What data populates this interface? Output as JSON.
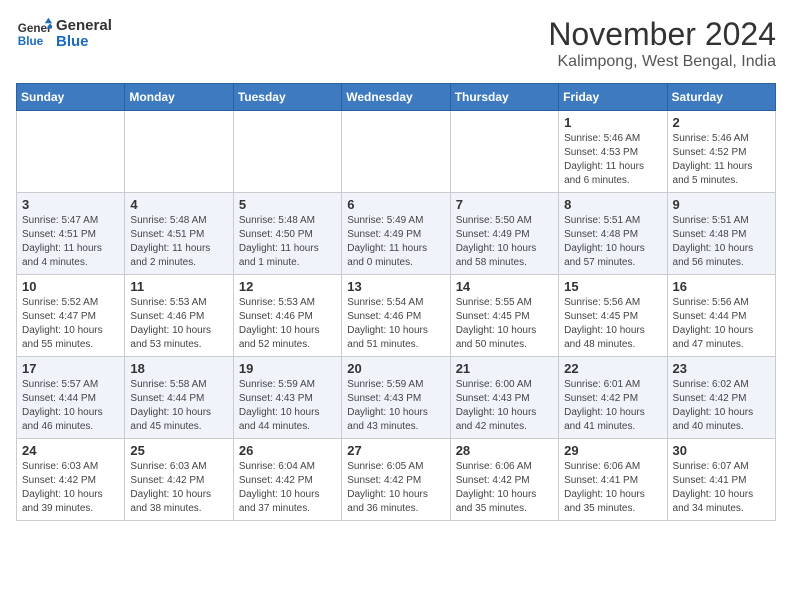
{
  "header": {
    "logo_general": "General",
    "logo_blue": "Blue",
    "month": "November 2024",
    "location": "Kalimpong, West Bengal, India"
  },
  "days_of_week": [
    "Sunday",
    "Monday",
    "Tuesday",
    "Wednesday",
    "Thursday",
    "Friday",
    "Saturday"
  ],
  "weeks": [
    [
      {
        "num": "",
        "info": ""
      },
      {
        "num": "",
        "info": ""
      },
      {
        "num": "",
        "info": ""
      },
      {
        "num": "",
        "info": ""
      },
      {
        "num": "",
        "info": ""
      },
      {
        "num": "1",
        "info": "Sunrise: 5:46 AM\nSunset: 4:53 PM\nDaylight: 11 hours and 6 minutes."
      },
      {
        "num": "2",
        "info": "Sunrise: 5:46 AM\nSunset: 4:52 PM\nDaylight: 11 hours and 5 minutes."
      }
    ],
    [
      {
        "num": "3",
        "info": "Sunrise: 5:47 AM\nSunset: 4:51 PM\nDaylight: 11 hours and 4 minutes."
      },
      {
        "num": "4",
        "info": "Sunrise: 5:48 AM\nSunset: 4:51 PM\nDaylight: 11 hours and 2 minutes."
      },
      {
        "num": "5",
        "info": "Sunrise: 5:48 AM\nSunset: 4:50 PM\nDaylight: 11 hours and 1 minute."
      },
      {
        "num": "6",
        "info": "Sunrise: 5:49 AM\nSunset: 4:49 PM\nDaylight: 11 hours and 0 minutes."
      },
      {
        "num": "7",
        "info": "Sunrise: 5:50 AM\nSunset: 4:49 PM\nDaylight: 10 hours and 58 minutes."
      },
      {
        "num": "8",
        "info": "Sunrise: 5:51 AM\nSunset: 4:48 PM\nDaylight: 10 hours and 57 minutes."
      },
      {
        "num": "9",
        "info": "Sunrise: 5:51 AM\nSunset: 4:48 PM\nDaylight: 10 hours and 56 minutes."
      }
    ],
    [
      {
        "num": "10",
        "info": "Sunrise: 5:52 AM\nSunset: 4:47 PM\nDaylight: 10 hours and 55 minutes."
      },
      {
        "num": "11",
        "info": "Sunrise: 5:53 AM\nSunset: 4:46 PM\nDaylight: 10 hours and 53 minutes."
      },
      {
        "num": "12",
        "info": "Sunrise: 5:53 AM\nSunset: 4:46 PM\nDaylight: 10 hours and 52 minutes."
      },
      {
        "num": "13",
        "info": "Sunrise: 5:54 AM\nSunset: 4:46 PM\nDaylight: 10 hours and 51 minutes."
      },
      {
        "num": "14",
        "info": "Sunrise: 5:55 AM\nSunset: 4:45 PM\nDaylight: 10 hours and 50 minutes."
      },
      {
        "num": "15",
        "info": "Sunrise: 5:56 AM\nSunset: 4:45 PM\nDaylight: 10 hours and 48 minutes."
      },
      {
        "num": "16",
        "info": "Sunrise: 5:56 AM\nSunset: 4:44 PM\nDaylight: 10 hours and 47 minutes."
      }
    ],
    [
      {
        "num": "17",
        "info": "Sunrise: 5:57 AM\nSunset: 4:44 PM\nDaylight: 10 hours and 46 minutes."
      },
      {
        "num": "18",
        "info": "Sunrise: 5:58 AM\nSunset: 4:44 PM\nDaylight: 10 hours and 45 minutes."
      },
      {
        "num": "19",
        "info": "Sunrise: 5:59 AM\nSunset: 4:43 PM\nDaylight: 10 hours and 44 minutes."
      },
      {
        "num": "20",
        "info": "Sunrise: 5:59 AM\nSunset: 4:43 PM\nDaylight: 10 hours and 43 minutes."
      },
      {
        "num": "21",
        "info": "Sunrise: 6:00 AM\nSunset: 4:43 PM\nDaylight: 10 hours and 42 minutes."
      },
      {
        "num": "22",
        "info": "Sunrise: 6:01 AM\nSunset: 4:42 PM\nDaylight: 10 hours and 41 minutes."
      },
      {
        "num": "23",
        "info": "Sunrise: 6:02 AM\nSunset: 4:42 PM\nDaylight: 10 hours and 40 minutes."
      }
    ],
    [
      {
        "num": "24",
        "info": "Sunrise: 6:03 AM\nSunset: 4:42 PM\nDaylight: 10 hours and 39 minutes."
      },
      {
        "num": "25",
        "info": "Sunrise: 6:03 AM\nSunset: 4:42 PM\nDaylight: 10 hours and 38 minutes."
      },
      {
        "num": "26",
        "info": "Sunrise: 6:04 AM\nSunset: 4:42 PM\nDaylight: 10 hours and 37 minutes."
      },
      {
        "num": "27",
        "info": "Sunrise: 6:05 AM\nSunset: 4:42 PM\nDaylight: 10 hours and 36 minutes."
      },
      {
        "num": "28",
        "info": "Sunrise: 6:06 AM\nSunset: 4:42 PM\nDaylight: 10 hours and 35 minutes."
      },
      {
        "num": "29",
        "info": "Sunrise: 6:06 AM\nSunset: 4:41 PM\nDaylight: 10 hours and 35 minutes."
      },
      {
        "num": "30",
        "info": "Sunrise: 6:07 AM\nSunset: 4:41 PM\nDaylight: 10 hours and 34 minutes."
      }
    ]
  ]
}
